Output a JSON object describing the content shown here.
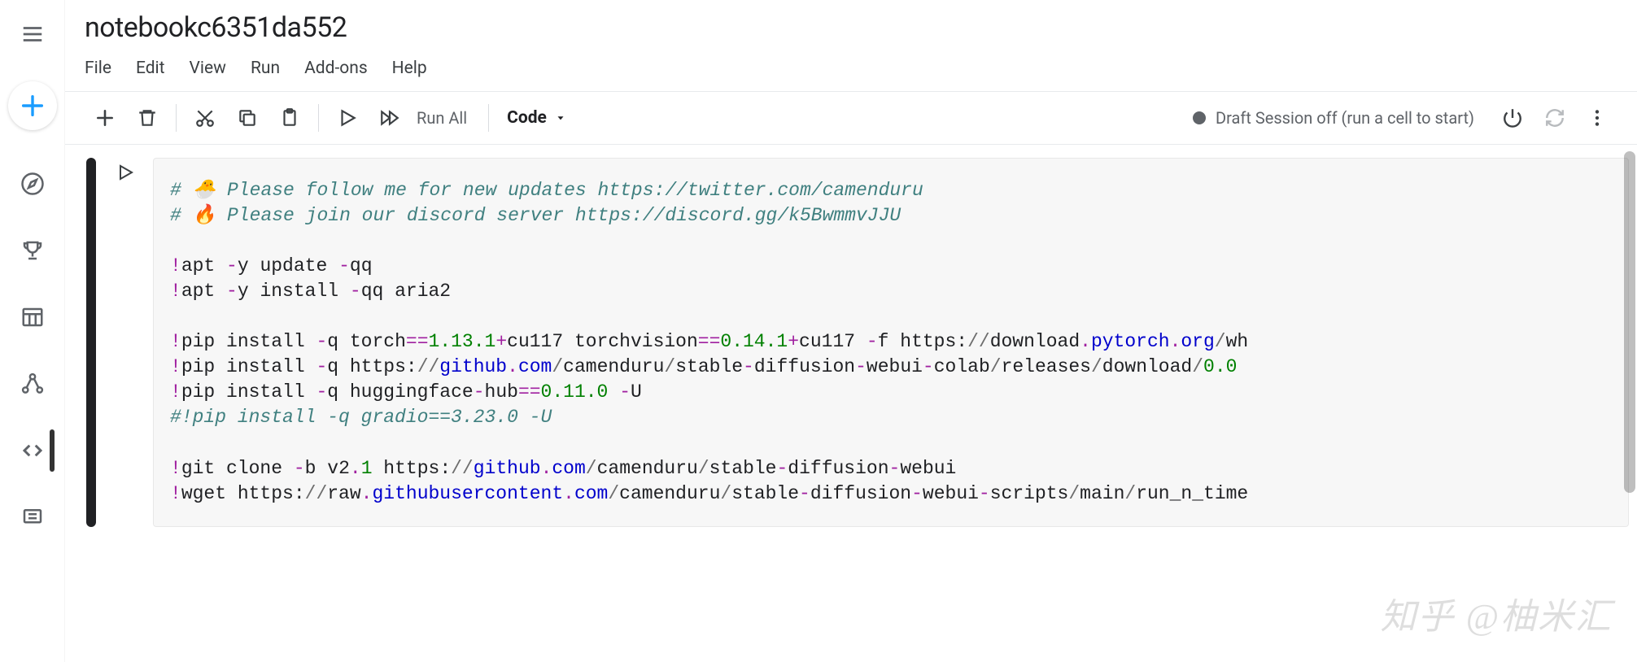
{
  "title": "notebookc6351da552",
  "menubar": [
    "File",
    "Edit",
    "View",
    "Run",
    "Add-ons",
    "Help"
  ],
  "toolbar": {
    "run_all_label": "Run All",
    "cell_type": "Code"
  },
  "session": {
    "status_text": "Draft Session off (run a cell to start)"
  },
  "code": {
    "lines": [
      {
        "t": "comment",
        "text": "# 🐣 Please follow me for new updates https://twitter.com/camenduru"
      },
      {
        "t": "comment",
        "text": "# 🔥 Please join our discord server https://discord.gg/k5BwmmvJJU"
      },
      {
        "t": "blank"
      },
      {
        "t": "cmd",
        "seg": [
          {
            "c": "op",
            "v": "!"
          },
          {
            "v": "apt "
          },
          {
            "c": "op",
            "v": "-"
          },
          {
            "v": "y update "
          },
          {
            "c": "op",
            "v": "-"
          },
          {
            "v": "qq"
          }
        ]
      },
      {
        "t": "cmd",
        "seg": [
          {
            "c": "op",
            "v": "!"
          },
          {
            "v": "apt "
          },
          {
            "c": "op",
            "v": "-"
          },
          {
            "v": "y install "
          },
          {
            "c": "op",
            "v": "-"
          },
          {
            "v": "qq aria2"
          }
        ]
      },
      {
        "t": "blank"
      },
      {
        "t": "cmd",
        "seg": [
          {
            "c": "op",
            "v": "!"
          },
          {
            "v": "pip install "
          },
          {
            "c": "op",
            "v": "-"
          },
          {
            "v": "q torch"
          },
          {
            "c": "op",
            "v": "=="
          },
          {
            "c": "num",
            "v": "1.13.1"
          },
          {
            "c": "op",
            "v": "+"
          },
          {
            "v": "cu117 torchvision"
          },
          {
            "c": "op",
            "v": "=="
          },
          {
            "c": "num",
            "v": "0.14.1"
          },
          {
            "c": "op",
            "v": "+"
          },
          {
            "v": "cu117 "
          },
          {
            "c": "op",
            "v": "-"
          },
          {
            "v": "f https:"
          },
          {
            "c": "sl",
            "v": "//"
          },
          {
            "v": "download"
          },
          {
            "c": "op",
            "v": "."
          },
          {
            "c": "pth",
            "v": "pytorch"
          },
          {
            "c": "op",
            "v": "."
          },
          {
            "c": "pth",
            "v": "org"
          },
          {
            "c": "sl",
            "v": "/"
          },
          {
            "v": "wh"
          }
        ]
      },
      {
        "t": "cmd",
        "seg": [
          {
            "c": "op",
            "v": "!"
          },
          {
            "v": "pip install "
          },
          {
            "c": "op",
            "v": "-"
          },
          {
            "v": "q https:"
          },
          {
            "c": "sl",
            "v": "//"
          },
          {
            "c": "pth",
            "v": "github"
          },
          {
            "c": "op",
            "v": "."
          },
          {
            "c": "pth",
            "v": "com"
          },
          {
            "c": "sl",
            "v": "/"
          },
          {
            "v": "camenduru"
          },
          {
            "c": "sl",
            "v": "/"
          },
          {
            "v": "stable"
          },
          {
            "c": "op",
            "v": "-"
          },
          {
            "v": "diffusion"
          },
          {
            "c": "op",
            "v": "-"
          },
          {
            "v": "webui"
          },
          {
            "c": "op",
            "v": "-"
          },
          {
            "v": "colab"
          },
          {
            "c": "sl",
            "v": "/"
          },
          {
            "v": "releases"
          },
          {
            "c": "sl",
            "v": "/"
          },
          {
            "v": "download"
          },
          {
            "c": "sl",
            "v": "/"
          },
          {
            "c": "num",
            "v": "0.0"
          }
        ]
      },
      {
        "t": "cmd",
        "seg": [
          {
            "c": "op",
            "v": "!"
          },
          {
            "v": "pip install "
          },
          {
            "c": "op",
            "v": "-"
          },
          {
            "v": "q huggingface"
          },
          {
            "c": "op",
            "v": "-"
          },
          {
            "v": "hub"
          },
          {
            "c": "op",
            "v": "=="
          },
          {
            "c": "num",
            "v": "0.11.0"
          },
          {
            "v": " "
          },
          {
            "c": "op",
            "v": "-"
          },
          {
            "v": "U"
          }
        ]
      },
      {
        "t": "comment",
        "text": "#!pip install -q gradio==3.23.0 -U"
      },
      {
        "t": "blank"
      },
      {
        "t": "cmd",
        "seg": [
          {
            "c": "op",
            "v": "!"
          },
          {
            "v": "git clone "
          },
          {
            "c": "op",
            "v": "-"
          },
          {
            "v": "b v2"
          },
          {
            "c": "op",
            "v": "."
          },
          {
            "c": "num",
            "v": "1"
          },
          {
            "v": " https:"
          },
          {
            "c": "sl",
            "v": "//"
          },
          {
            "c": "pth",
            "v": "github"
          },
          {
            "c": "op",
            "v": "."
          },
          {
            "c": "pth",
            "v": "com"
          },
          {
            "c": "sl",
            "v": "/"
          },
          {
            "v": "camenduru"
          },
          {
            "c": "sl",
            "v": "/"
          },
          {
            "v": "stable"
          },
          {
            "c": "op",
            "v": "-"
          },
          {
            "v": "diffusion"
          },
          {
            "c": "op",
            "v": "-"
          },
          {
            "v": "webui"
          }
        ]
      },
      {
        "t": "cmd",
        "seg": [
          {
            "c": "op",
            "v": "!"
          },
          {
            "v": "wget https:"
          },
          {
            "c": "sl",
            "v": "//"
          },
          {
            "v": "raw"
          },
          {
            "c": "op",
            "v": "."
          },
          {
            "c": "pth",
            "v": "githubusercontent"
          },
          {
            "c": "op",
            "v": "."
          },
          {
            "c": "pth",
            "v": "com"
          },
          {
            "c": "sl",
            "v": "/"
          },
          {
            "v": "camenduru"
          },
          {
            "c": "sl",
            "v": "/"
          },
          {
            "v": "stable"
          },
          {
            "c": "op",
            "v": "-"
          },
          {
            "v": "diffusion"
          },
          {
            "c": "op",
            "v": "-"
          },
          {
            "v": "webui"
          },
          {
            "c": "op",
            "v": "-"
          },
          {
            "v": "scripts"
          },
          {
            "c": "sl",
            "v": "/"
          },
          {
            "v": "main"
          },
          {
            "c": "sl",
            "v": "/"
          },
          {
            "v": "run_n_time"
          }
        ]
      }
    ]
  },
  "watermark": "知乎 @柚米汇"
}
